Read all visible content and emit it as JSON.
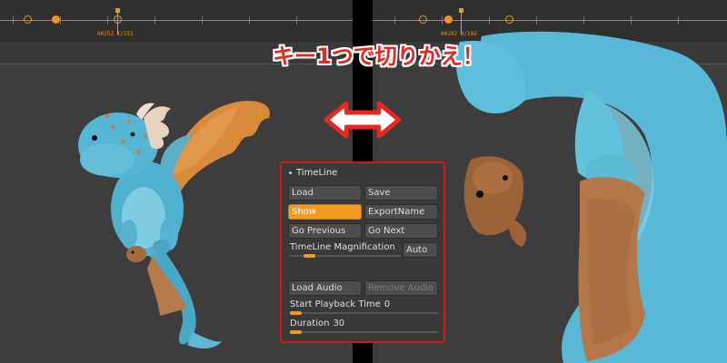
{
  "caption": "キー1つで切りかえ！",
  "colors": {
    "accent": "#f39a1f",
    "highlight_border": "#d41818",
    "panel_bg": "#3a3a3a",
    "button_bg": "#4d4d4d"
  },
  "timeline_left": {
    "frame_label": "00252  1/151"
  },
  "timeline_right": {
    "frame_label": "00192  0/192"
  },
  "panel": {
    "title": "TimeLine",
    "buttons": {
      "load": "Load",
      "save": "Save",
      "show": "Show",
      "export_name": "ExportName",
      "go_previous": "Go Previous",
      "go_next": "Go Next",
      "auto": "Auto",
      "load_audio": "Load Audio",
      "remove_audio": "Remove Audio"
    },
    "magnification": {
      "label": "TimeLine Magnification",
      "level": 0.12
    },
    "start_playback_time": {
      "label": "Start Playback Time",
      "value": "0",
      "level": 0.0
    },
    "duration": {
      "label": "Duration",
      "value": "30",
      "level": 0.0
    }
  }
}
